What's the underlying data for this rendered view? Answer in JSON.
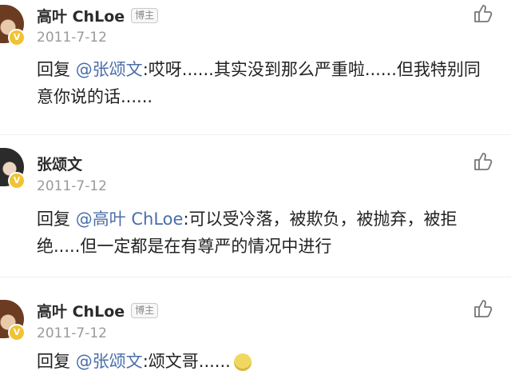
{
  "comments": [
    {
      "name": "高叶 ChLoe",
      "tag": "博主",
      "date": "2011-7-12",
      "reply_prefix": "回复 ",
      "mention": "@张颂文",
      "body": ":哎呀......其实没到那么严重啦......但我特别同意你说的话......"
    },
    {
      "name": "张颂文",
      "tag": "",
      "date": "2011-7-12",
      "reply_prefix": "回复 ",
      "mention": "@高叶 ChLoe",
      "body": ":可以受冷落，被欺负，被抛弃，被拒绝.....但一定都是在有尊严的情况中进行"
    },
    {
      "name": "高叶 ChLoe",
      "tag": "博主",
      "date": "2011-7-12",
      "reply_prefix": "回复 ",
      "mention": "@张颂文",
      "body": ":颂文哥......"
    }
  ],
  "icons": {
    "like": "thumbs-up-icon",
    "verified": "verified-badge-icon",
    "emoji": "grimace-emoji-icon"
  },
  "colors": {
    "mention": "#4a6ea9",
    "badge": "#f1c232",
    "date": "#9a9a9a"
  }
}
